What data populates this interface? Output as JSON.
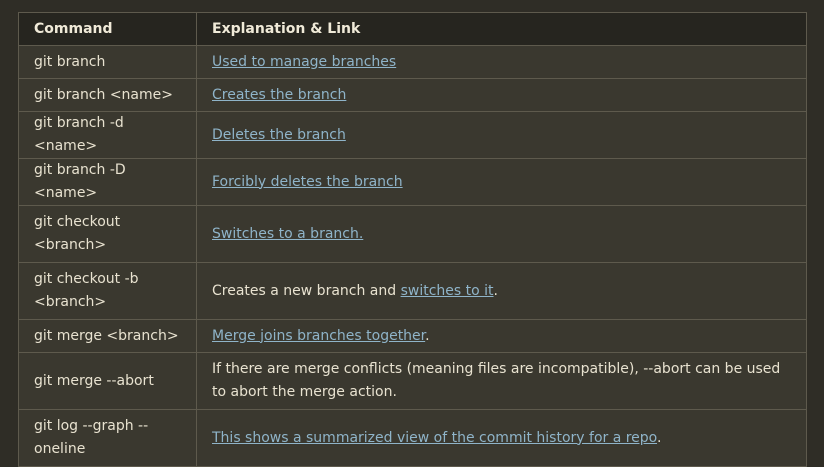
{
  "table": {
    "headers": {
      "command": "Command",
      "explanation": "Explanation & Link"
    },
    "rows": [
      {
        "command": "git branch",
        "pre": "",
        "link": "Used to manage branches",
        "post": ""
      },
      {
        "command": "git branch <name>",
        "pre": "",
        "link": "Creates the branch",
        "post": ""
      },
      {
        "command": "git branch -d <name>",
        "pre": "",
        "link": "Deletes the branch",
        "post": ""
      },
      {
        "command": "git branch -D <name>",
        "pre": "",
        "link": "Forcibly deletes the branch",
        "post": ""
      },
      {
        "command": "git checkout <branch>",
        "pre": "",
        "link": "Switches to a branch.",
        "post": ""
      },
      {
        "command": "git checkout -b <branch>",
        "pre": "Creates a new branch and ",
        "link": "switches to it",
        "post": "."
      },
      {
        "command": "git merge <branch>",
        "pre": "",
        "link": "Merge joins branches together",
        "post": "."
      },
      {
        "command": "git merge --abort",
        "pre": "If there are merge conflicts (meaning files are incompatible), --abort can be used to abort the merge action.",
        "link": "",
        "post": ""
      },
      {
        "command": "git log --graph --oneline",
        "pre": "",
        "link": "This shows a summarized view of the commit history for a repo",
        "post": "."
      }
    ]
  },
  "colors": {
    "background": "#2f2d26",
    "header_bg": "#26251f",
    "row_bg": "#3a382f",
    "border": "#5e5a4d",
    "link": "#8fb4c9"
  }
}
